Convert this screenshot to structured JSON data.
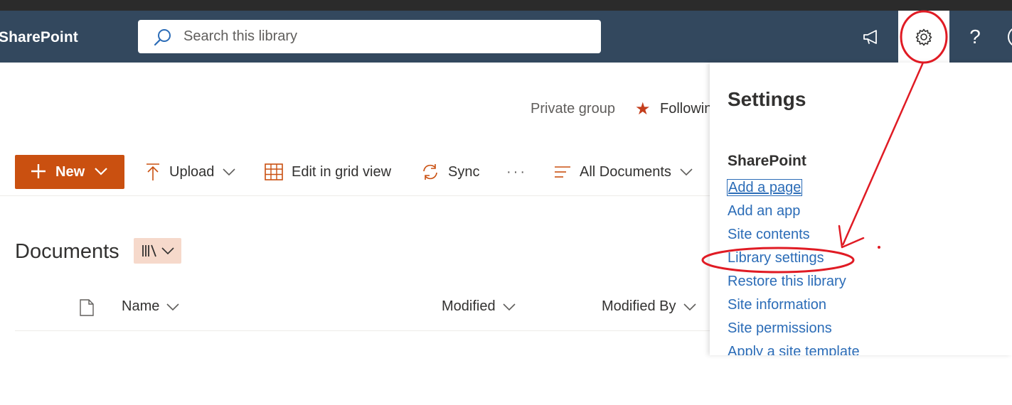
{
  "suite_bar": {
    "app_title": "SharePoint",
    "search_placeholder": "Search this library",
    "icons": [
      "search-icon",
      "megaphone-icon",
      "gear-icon",
      "help-icon"
    ],
    "help_glyph": "?",
    "brand_color": "#33485e"
  },
  "site_header": {
    "group_type": "Private group",
    "follow_label": "Following"
  },
  "command_bar": {
    "new_label": "New",
    "upload_label": "Upload",
    "grid_label": "Edit in grid view",
    "sync_label": "Sync",
    "more_glyph": "···",
    "view_label": "All Documents",
    "accent_color": "#ca5010"
  },
  "library": {
    "title": "Documents",
    "columns": [
      "Name",
      "Modified",
      "Modified By"
    ]
  },
  "settings_panel": {
    "title": "Settings",
    "section": "SharePoint",
    "links": [
      "Add a page",
      "Add an app",
      "Site contents",
      "Library settings",
      "Restore this library",
      "Site information",
      "Site permissions",
      "Apply a site template"
    ],
    "link_color": "#2b6cb7"
  },
  "annotation": {
    "color": "#e01b24",
    "marks": [
      "circle around gear icon",
      "arrow to Library settings",
      "ellipse around Library settings"
    ]
  }
}
